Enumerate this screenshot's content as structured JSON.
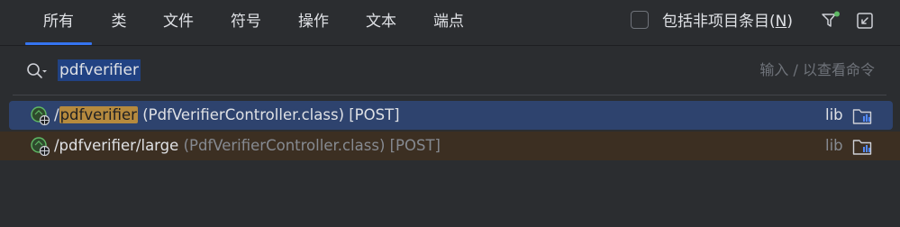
{
  "tabs": [
    {
      "label": "所有",
      "active": true
    },
    {
      "label": "类"
    },
    {
      "label": "文件"
    },
    {
      "label": "符号"
    },
    {
      "label": "操作"
    },
    {
      "label": "文本"
    },
    {
      "label": "端点"
    }
  ],
  "include_non_project": {
    "label": "包括非项目条目(",
    "mnemonic": "N",
    "suffix": ")",
    "checked": false
  },
  "search": {
    "query": "pdfverifier",
    "hint": "输入 / 以查看命令"
  },
  "results": [
    {
      "path_prefix": "/",
      "path_highlight": "pdfverifier",
      "path_suffix": "",
      "controller": "(PdfVerifierController.class) [POST]",
      "library": "lib",
      "selected": true
    },
    {
      "path_prefix": "/pdfverifier/large",
      "path_highlight": "",
      "path_suffix": "",
      "controller": "(PdfVerifierController.class) [POST]",
      "library": "lib",
      "selected": false
    }
  ],
  "colors": {
    "background": "#2b2d30",
    "accent": "#3574f0",
    "selection": "#2e436e",
    "match_highlight": "#b68a3e",
    "secondary_row": "#3c2f22",
    "endpoint_green": "#5fb865"
  }
}
